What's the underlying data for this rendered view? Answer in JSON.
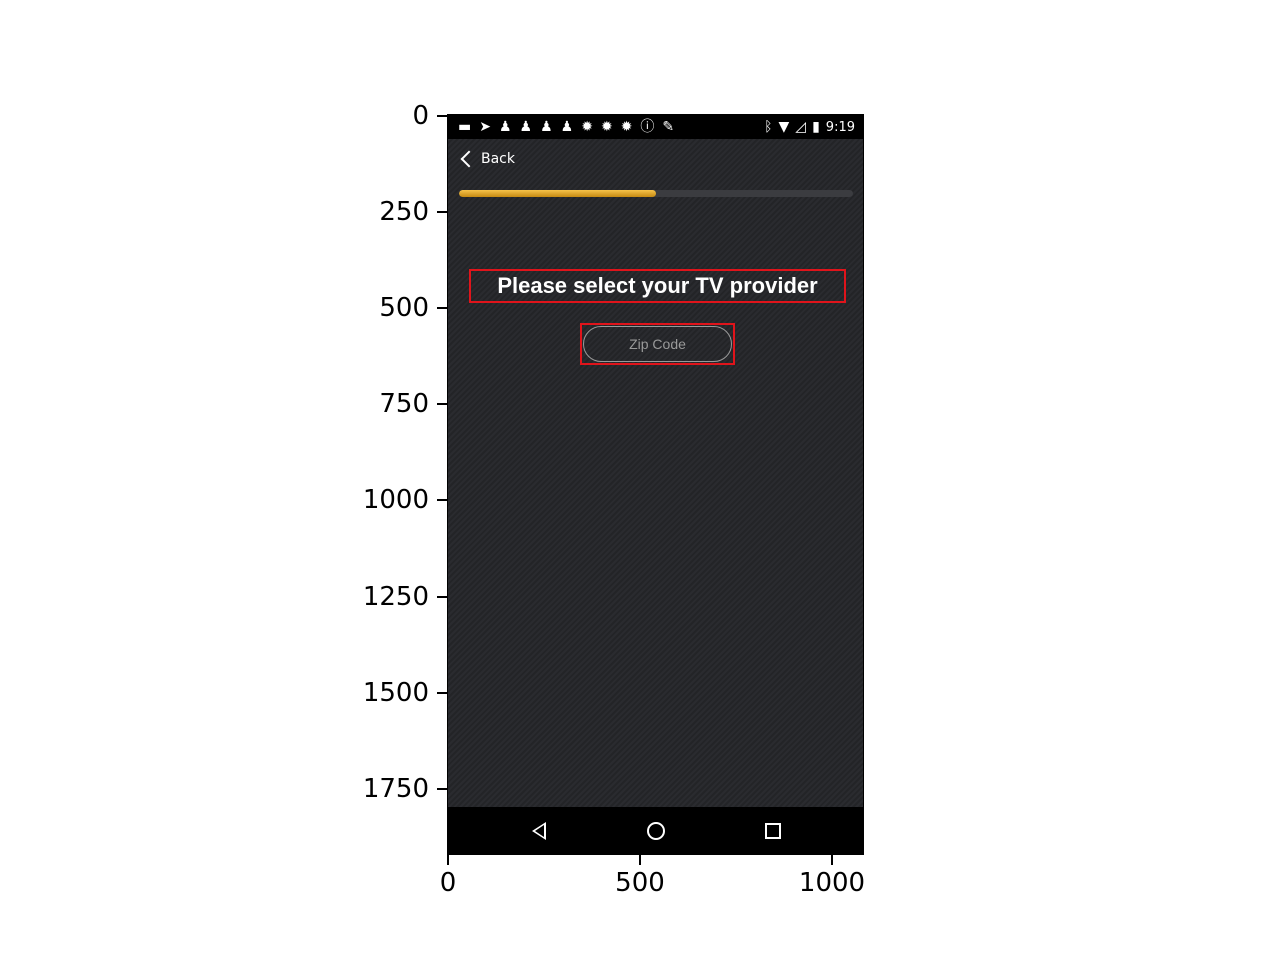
{
  "axes": {
    "y_ticks": [
      "0",
      "250",
      "500",
      "750",
      "1000",
      "1250",
      "1500",
      "1750"
    ],
    "x_ticks": [
      "0",
      "500",
      "1000"
    ]
  },
  "status_bar": {
    "time": "9:19",
    "left_icons": [
      "message-icon",
      "send-icon",
      "chess-pawn-icon",
      "chess-pawn-icon",
      "chess-pawn-icon",
      "chess-pawn-icon",
      "dragon-icon",
      "dragon-icon",
      "dragon-icon",
      "info-icon",
      "tools-icon"
    ],
    "right_icons": [
      "bluetooth-icon",
      "wifi-icon",
      "no-signal-icon",
      "battery-icon"
    ]
  },
  "header": {
    "back_label": "Back"
  },
  "progress": {
    "value": 0.5,
    "fill_color": "#e0a72a"
  },
  "main": {
    "title": "Please select your TV provider",
    "zip_placeholder": "Zip Code"
  },
  "highlight_color": "#e0141b"
}
